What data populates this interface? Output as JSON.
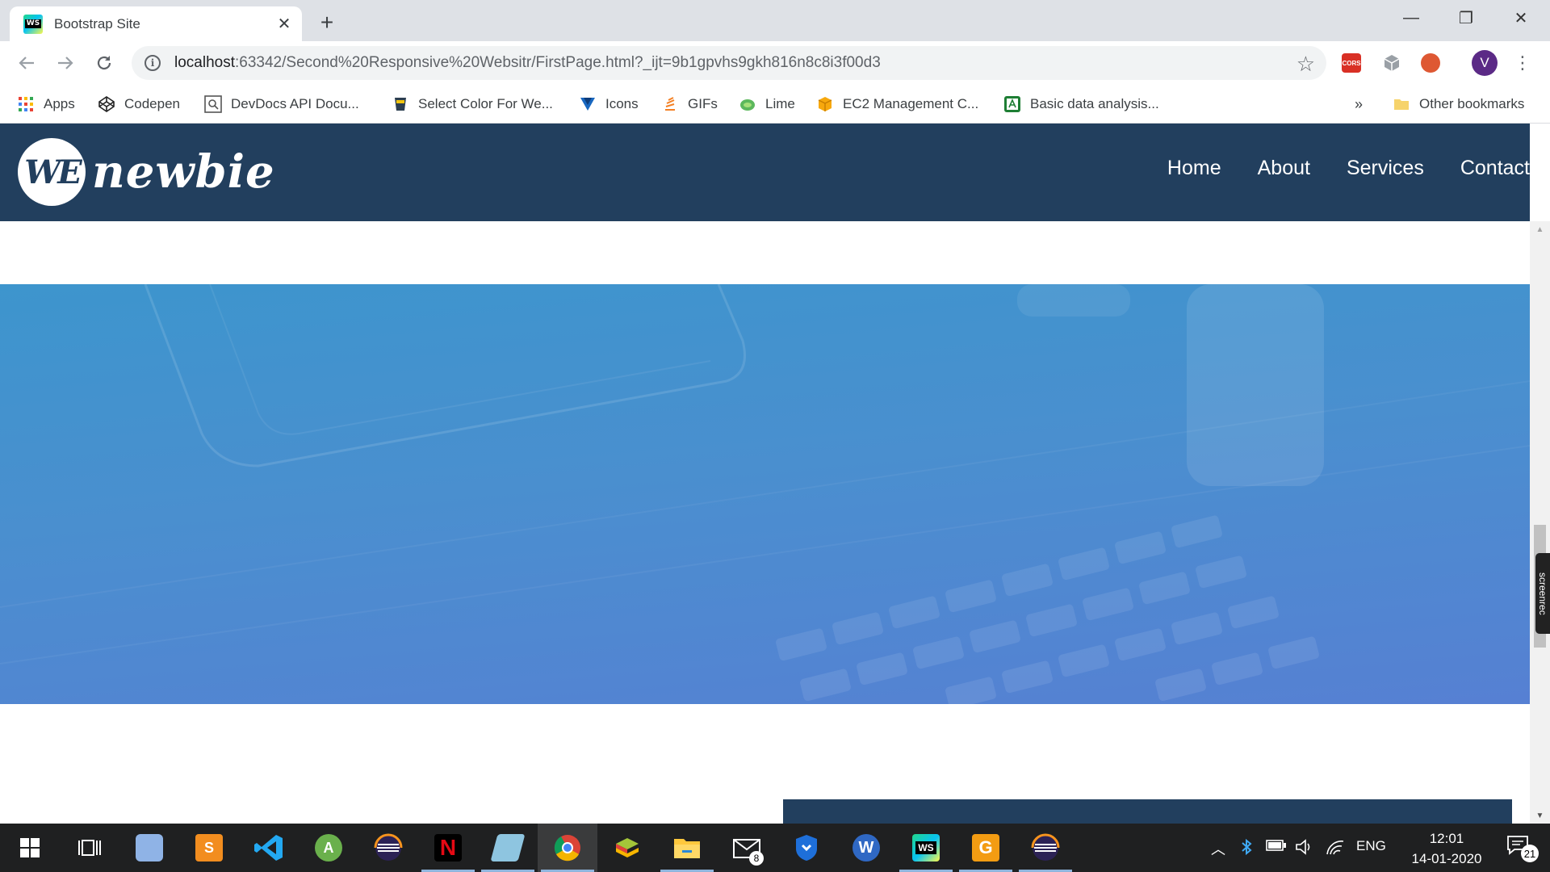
{
  "browser": {
    "tab_title": "Bootstrap Site",
    "tab_close": "✕",
    "new_tab": "+",
    "window_controls": {
      "minimize": "—",
      "restore": "❐",
      "close": "✕"
    },
    "url_host": "localhost",
    "url_rest": ":63342/Second%20Responsive%20Websitr/FirstPage.html?_ijt=9b1gpvhs9gkh816n8c8i3f00d3",
    "profile_initial": "V",
    "extensions": [
      "cors-extension-icon",
      "cube-extension-icon",
      "duckduckgo-icon"
    ],
    "bookmarks": [
      {
        "label": "Apps",
        "icon": "apps-grid-icon"
      },
      {
        "label": "Codepen",
        "icon": "codepen-icon"
      },
      {
        "label": "DevDocs API Docu...",
        "icon": "devdocs-icon"
      },
      {
        "label": "Select Color For We...",
        "icon": "color-picker-icon"
      },
      {
        "label": "Icons",
        "icon": "vuetify-icon"
      },
      {
        "label": "GIFs",
        "icon": "gifs-icon"
      },
      {
        "label": "Lime",
        "icon": "lime-icon"
      },
      {
        "label": "EC2 Management C...",
        "icon": "aws-box-icon"
      },
      {
        "label": "Basic data analysis...",
        "icon": "android-studio-icon"
      }
    ],
    "bookmarks_overflow": "»",
    "other_bookmarks": "Other bookmarks"
  },
  "site": {
    "logo_mark": "WE",
    "logo_text": "newbie",
    "nav": [
      "Home",
      "About",
      "Services",
      "Contact"
    ],
    "brand_color": "#223f5e",
    "hero_colors": [
      "#3d95cd",
      "#5680d3"
    ]
  },
  "screenrec_label": "screenrec",
  "taskbar": {
    "apps": [
      "windows-start-icon",
      "task-view-icon",
      "virtualbox-icon",
      "sublime-text-icon",
      "vscode-icon",
      "android-studio-icon",
      "eclipse-icon",
      "netflix-icon",
      "notepad-icon",
      "chrome-icon",
      "bluestacks-icon",
      "file-explorer-icon",
      "mail-icon",
      "brave-icon",
      "wps-writer-icon",
      "webstorm-icon",
      "pdf-tool-icon",
      "eclipse-icon"
    ],
    "mail_badge": "8",
    "language": "ENG",
    "time": "12:01",
    "date": "14-01-2020",
    "notification_count": "21"
  }
}
